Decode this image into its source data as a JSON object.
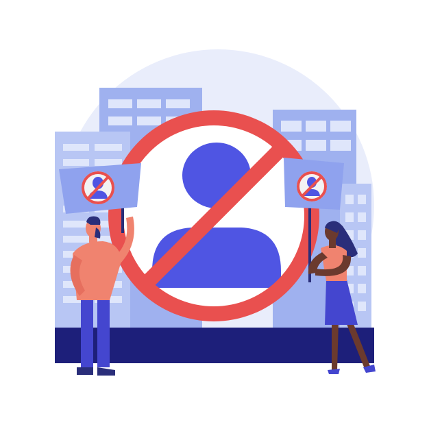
{
  "illustration": {
    "subject": "protest-against-person-ban",
    "icons": [
      "prohibition-sign-icon",
      "person-silhouette-icon",
      "protest-sign-icon"
    ],
    "colors": {
      "background": "#ffffff",
      "halo": "#e9edfb",
      "building_light": "#b8c6f4",
      "building_mid": "#9fb1ef",
      "window": "#dfe6fb",
      "ground": "#1d1f7a",
      "prohibition_red": "#e9504f",
      "person_blue": "#4f55e3",
      "skin_light": "#f0836f",
      "skin_dark": "#3b2420",
      "hair": "#2a2e7a",
      "pants": "#4446cf"
    }
  }
}
